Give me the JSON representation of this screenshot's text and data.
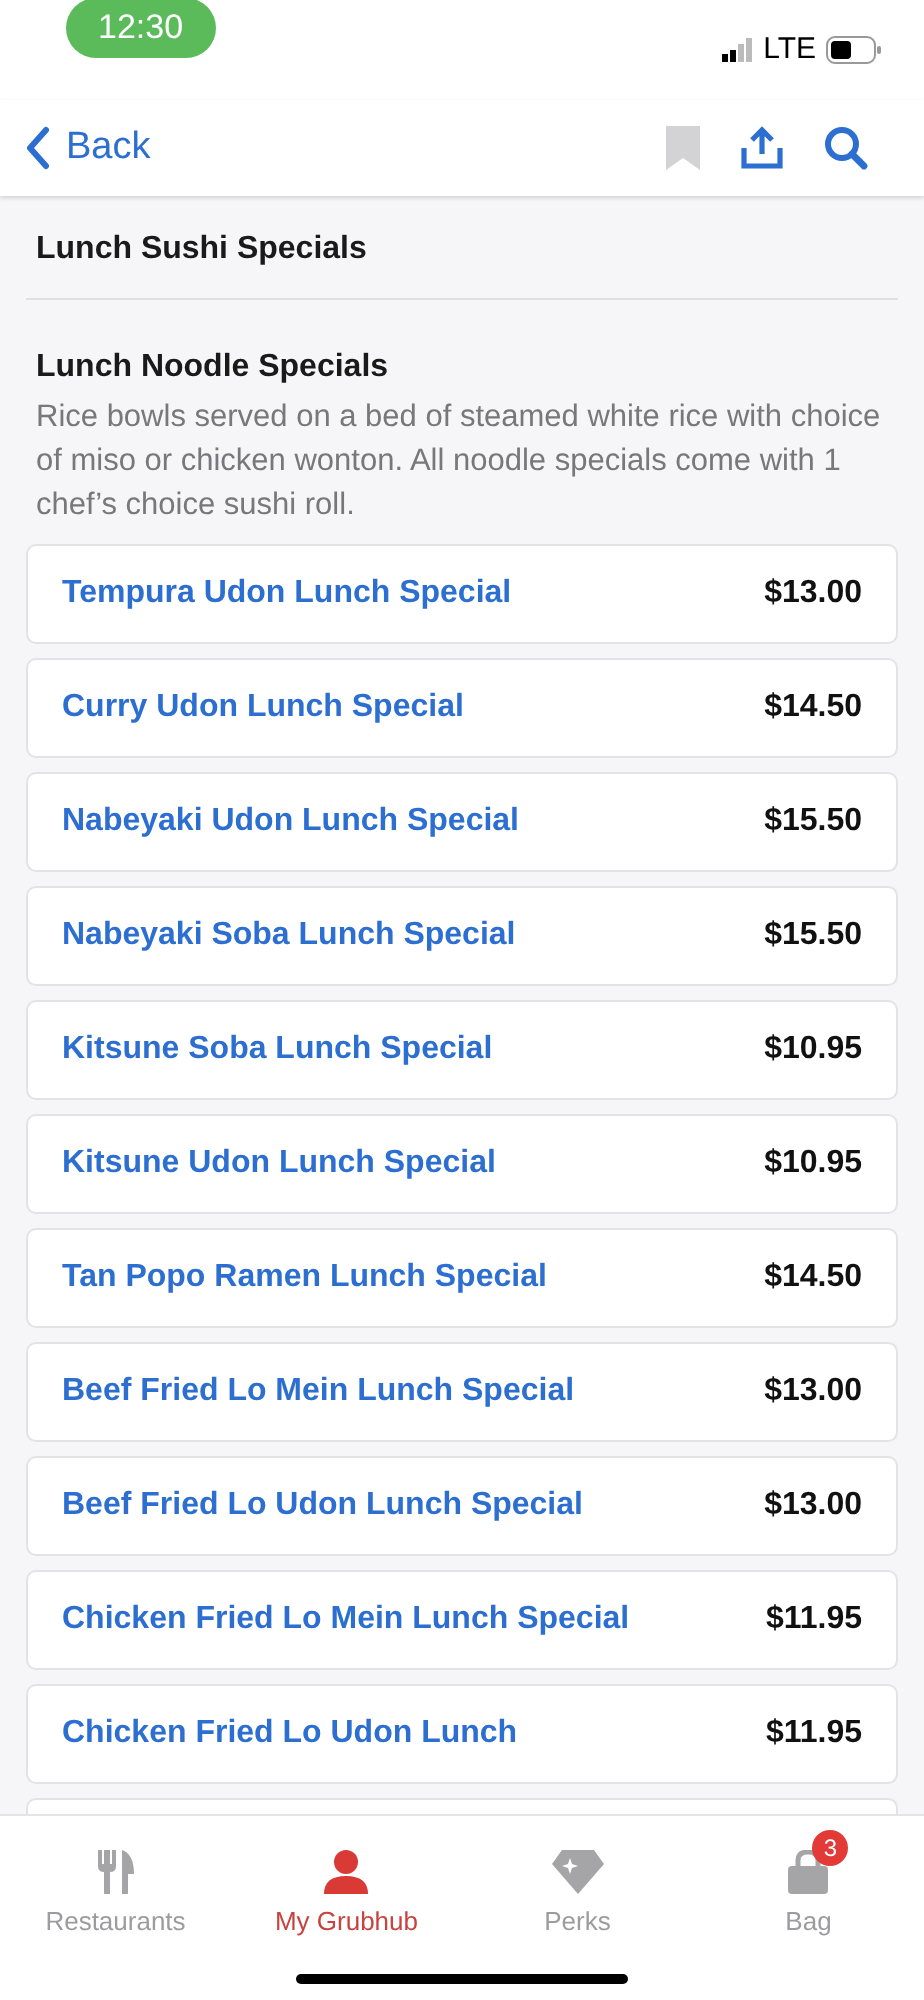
{
  "status_bar": {
    "time": "12:30",
    "network": "LTE"
  },
  "nav": {
    "back": "Back"
  },
  "sections": [
    {
      "title": "Lunch Sushi Specials"
    },
    {
      "title": "Lunch Noodle Specials",
      "description": "Rice bowls served on a bed of steamed white rice with choice of miso or chicken wonton. All noodle specials come with 1 chef’s choice sushi roll."
    }
  ],
  "items": [
    {
      "name": "Tempura Udon Lunch Special",
      "price": "$13.00"
    },
    {
      "name": "Curry Udon Lunch Special",
      "price": "$14.50"
    },
    {
      "name": "Nabeyaki Udon Lunch Special",
      "price": "$15.50"
    },
    {
      "name": "Nabeyaki Soba Lunch Special",
      "price": "$15.50"
    },
    {
      "name": "Kitsune Soba Lunch Special",
      "price": "$10.95"
    },
    {
      "name": "Kitsune Udon Lunch Special",
      "price": "$10.95"
    },
    {
      "name": "Tan Popo Ramen Lunch Special",
      "price": "$14.50"
    },
    {
      "name": "Beef Fried Lo Mein Lunch Special",
      "price": "$13.00"
    },
    {
      "name": "Beef Fried Lo Udon Lunch Special",
      "price": "$13.00"
    },
    {
      "name": "Chicken Fried Lo Mein Lunch Special",
      "price": "$11.95"
    },
    {
      "name": "Chicken Fried Lo Udon Lunch",
      "price": "$11.95"
    }
  ],
  "tabs": [
    {
      "kind": "restaurants",
      "label": "Restaurants",
      "selected": false
    },
    {
      "kind": "account",
      "label": "My Grubhub",
      "selected": true
    },
    {
      "kind": "perks",
      "label": "Perks",
      "selected": false
    },
    {
      "kind": "bag",
      "label": "Bag",
      "selected": false,
      "badge": "3"
    }
  ]
}
